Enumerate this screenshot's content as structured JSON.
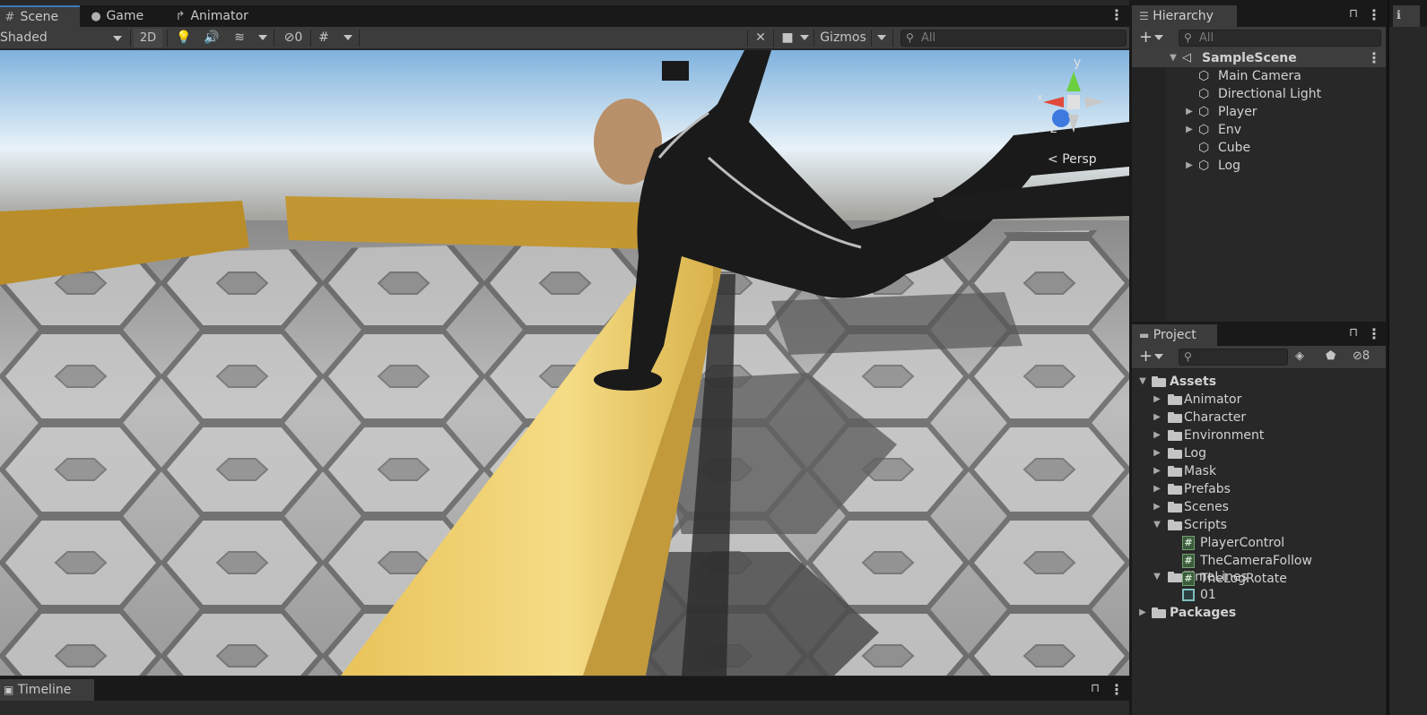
{
  "scene_tabs": [
    {
      "label": "Scene",
      "icon": "grid-icon"
    },
    {
      "label": "Game",
      "icon": "gamepad-icon"
    },
    {
      "label": "Animator",
      "icon": "animator-icon"
    }
  ],
  "scene_toolbar": {
    "draw_mode": "Shaded",
    "two_d_label": "2D",
    "hidden_count": "0",
    "gizmos_label": "Gizmos",
    "search_placeholder": "All"
  },
  "scene_gizmo": {
    "y_label": "y",
    "x_label": "x",
    "z_label": "z",
    "projection_label": "Persp"
  },
  "timeline_tab": {
    "label": "Timeline"
  },
  "hierarchy": {
    "title": "Hierarchy",
    "search_placeholder": "All",
    "scene_name": "SampleScene",
    "items": [
      {
        "label": "Main Camera",
        "expandable": false
      },
      {
        "label": "Directional Light",
        "expandable": false
      },
      {
        "label": "Player",
        "expandable": true
      },
      {
        "label": "Env",
        "expandable": true
      },
      {
        "label": "Cube",
        "expandable": false
      },
      {
        "label": "Log",
        "expandable": true
      }
    ]
  },
  "project": {
    "title": "Project",
    "search_placeholder": "",
    "hidden_count": "8",
    "root_label": "Assets",
    "folders": [
      {
        "label": "Animator"
      },
      {
        "label": "Character"
      },
      {
        "label": "Environment"
      },
      {
        "label": "Log"
      },
      {
        "label": "Mask"
      },
      {
        "label": "Prefabs"
      },
      {
        "label": "Scenes"
      },
      {
        "label": "Scripts"
      }
    ],
    "scripts": [
      {
        "label": "PlayerControl"
      },
      {
        "label": "TheCameraFollow"
      },
      {
        "label": "TheLogRotate"
      }
    ],
    "timelines_label": "TimeLines",
    "timeline_asset": "01",
    "packages_label": "Packages"
  },
  "colors": {
    "accent_tab": "#3a79bb",
    "log_yellow": "#f0d06e",
    "panel_bg": "#282828"
  }
}
